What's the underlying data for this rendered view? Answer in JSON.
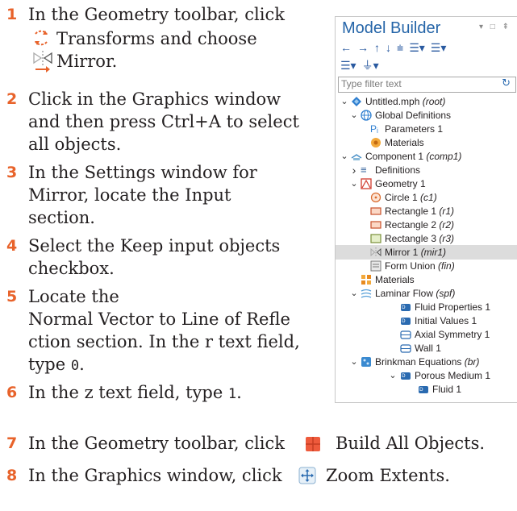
{
  "steps": [
    {
      "num": "1",
      "text_a": "In the Geometry toolbar, click",
      "text_b": "Transforms and choose",
      "text_c": "Mirror."
    },
    {
      "num": "2",
      "lines": [
        "Click in the Graphics window",
        "and then press Ctrl+A to select",
        "all objects."
      ]
    },
    {
      "num": "3",
      "lines": [
        "In the Settings window for",
        "Mirror, locate the Input",
        "section."
      ]
    },
    {
      "num": "4",
      "lines": [
        "Select the Keep input objects",
        "checkbox."
      ]
    },
    {
      "num": "5",
      "line1": "Locate the",
      "line2": "Normal Vector to Line of Refle",
      "line3_a": "ction section. In the r text field,",
      "line4_a": "type ",
      "line4_code": "0",
      "line4_b": "."
    },
    {
      "num": "6",
      "text_a": "In the z text field, type ",
      "code": "1",
      "text_b": "."
    },
    {
      "num": "7",
      "text_a": "In the Geometry toolbar, click",
      "text_b": "Build All Objects."
    },
    {
      "num": "8",
      "text_a": "In the Graphics window, click",
      "text_b": "Zoom Extents."
    }
  ],
  "panel": {
    "title": "Model Builder",
    "window_controls": "▾ □ ⇞",
    "filter_placeholder": "Type filter text",
    "icons": {
      "accent": "#e8632b",
      "blue": "#2565a8"
    },
    "tree": [
      {
        "label": "Untitled.mph",
        "tag": "(root)",
        "arrow": "⌄"
      },
      {
        "label": "Global Definitions",
        "tag": "",
        "arrow": "⌄"
      },
      {
        "label": "Parameters 1",
        "tag": "",
        "arrow": ""
      },
      {
        "label": "Materials",
        "tag": "",
        "arrow": ""
      },
      {
        "label": "Component 1",
        "tag": "(comp1)",
        "arrow": "⌄"
      },
      {
        "label": "Definitions",
        "tag": "",
        "arrow": "›"
      },
      {
        "label": "Geometry 1",
        "tag": "",
        "arrow": "⌄"
      },
      {
        "label": "Circle 1",
        "tag": "(c1)",
        "arrow": ""
      },
      {
        "label": "Rectangle 1",
        "tag": "(r1)",
        "arrow": ""
      },
      {
        "label": "Rectangle 2",
        "tag": "(r2)",
        "arrow": ""
      },
      {
        "label": "Rectangle 3",
        "tag": "(r3)",
        "arrow": ""
      },
      {
        "label": "Mirror 1",
        "tag": "(mir1)",
        "arrow": ""
      },
      {
        "label": "Form Union",
        "tag": "(fin)",
        "arrow": ""
      },
      {
        "label": "Materials",
        "tag": "",
        "arrow": ""
      },
      {
        "label": "Laminar Flow",
        "tag": "(spf)",
        "arrow": "⌄"
      },
      {
        "label": "Fluid Properties 1",
        "tag": "",
        "arrow": ""
      },
      {
        "label": "Initial Values 1",
        "tag": "",
        "arrow": ""
      },
      {
        "label": "Axial Symmetry 1",
        "tag": "",
        "arrow": ""
      },
      {
        "label": "Wall 1",
        "tag": "",
        "arrow": ""
      },
      {
        "label": "Brinkman Equations",
        "tag": "(br)",
        "arrow": "⌄"
      },
      {
        "label": "Porous Medium 1",
        "tag": "",
        "arrow": "⌄"
      },
      {
        "label": "Fluid 1",
        "tag": "",
        "arrow": ""
      }
    ]
  }
}
